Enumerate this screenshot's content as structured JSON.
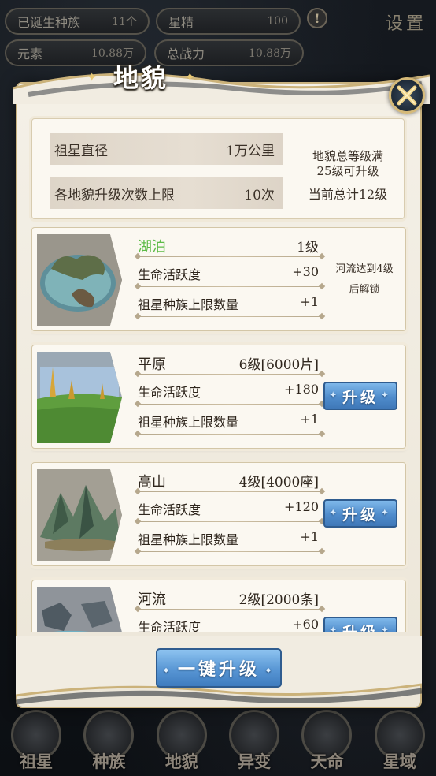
{
  "hud": {
    "race_label": "已诞生种族",
    "race_value": "11个",
    "essence_label": "星精",
    "essence_value": "100",
    "element_label": "元素",
    "element_value": "10.88万",
    "power_label": "总战力",
    "power_value": "10.88万",
    "settings_label": "设置",
    "alert_symbol": "!"
  },
  "dialog": {
    "title": "地貌",
    "close_icon": "close-x-icon",
    "summary": {
      "rows": [
        {
          "label": "祖星直径",
          "value": "1万公里"
        },
        {
          "label": "各地貌升级次数上限",
          "value": "10次"
        }
      ],
      "side_line1": "地貌总等级满",
      "side_line2": "25级可升级",
      "side_line3": "当前总计12级"
    },
    "terrains": [
      {
        "name": "湖泊",
        "level": "1级",
        "stat1_label": "生命活跃度",
        "stat1_value": "+30",
        "stat2_label": "祖星种族上限数量",
        "stat2_value": "+1",
        "lock_note_1": "河流达到4级",
        "lock_note_2": "后解锁"
      },
      {
        "name": "平原",
        "level": "6级[6000片]",
        "stat1_label": "生命活跃度",
        "stat1_value": "+180",
        "stat2_label": "祖星种族上限数量",
        "stat2_value": "+1",
        "button": "升级"
      },
      {
        "name": "高山",
        "level": "4级[4000座]",
        "stat1_label": "生命活跃度",
        "stat1_value": "+120",
        "stat2_label": "祖星种族上限数量",
        "stat2_value": "+1",
        "button": "升级"
      },
      {
        "name": "河流",
        "level": "2级[2000条]",
        "stat1_label": "生命活跃度",
        "stat1_value": "+60",
        "button": "升级"
      }
    ],
    "one_key_button": "一键升级"
  },
  "bottom_nav": [
    {
      "label": "祖星"
    },
    {
      "label": "种族"
    },
    {
      "label": "地貌"
    },
    {
      "label": "异变"
    },
    {
      "label": "天命"
    },
    {
      "label": "星域"
    }
  ],
  "colors": {
    "accent_blue": "#4f8ccc",
    "name_green": "#5cbb46",
    "gold_trim": "#d5b978",
    "paper": "#fbf8f1"
  }
}
